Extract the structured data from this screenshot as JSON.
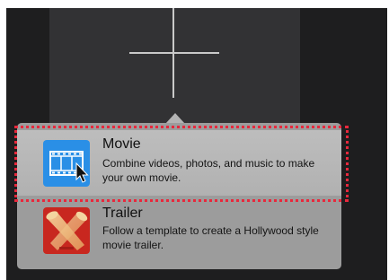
{
  "popover": {
    "options": [
      {
        "title": "Movie",
        "description": "Combine videos, photos, and music to make your own movie.",
        "icon": "film-strip-icon"
      },
      {
        "title": "Trailer",
        "description": "Follow a template to create a Hollywood style movie trailer.",
        "icon": "spotlights-icon"
      }
    ]
  },
  "create_tile": {
    "icon": "plus-icon"
  },
  "colors": {
    "movie_icon_bg": "#2a8fe6",
    "trailer_icon_bg": "#c8271f",
    "highlight": "#e8283c"
  }
}
